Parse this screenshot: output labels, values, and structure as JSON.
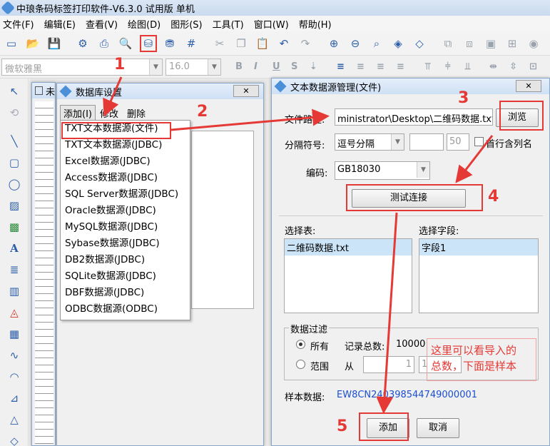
{
  "window": {
    "title": "中琅条码标签打印软件-V6.3.0 试用版 单机"
  },
  "menubar": {
    "items": [
      "文件(F)",
      "编辑(E)",
      "查看(V)",
      "绘图(D)",
      "图形(S)",
      "工具(T)",
      "窗口(W)",
      "帮助(H)"
    ]
  },
  "fontbar": {
    "font": "微软雅黑",
    "size": "16.0"
  },
  "doc_window": {
    "title_fragment": "未"
  },
  "db_dialog": {
    "title": "数据库设置",
    "menu": {
      "add": "添加(I)",
      "edit": "修改",
      "delete": "删除"
    },
    "add_menu_items": [
      "TXT文本数据源(文件)",
      "TXT文本数据源(JDBC)",
      "Excel数据源(JDBC)",
      "Access数据源(JDBC)",
      "SQL Server数据源(JDBC)",
      "Oracle数据源(JDBC)",
      "MySQL数据源(JDBC)",
      "Sybase数据源(JDBC)",
      "DB2数据源(JDBC)",
      "SQLite数据源(JDBC)",
      "DBF数据源(JDBC)",
      "ODBC数据源(ODBC)"
    ]
  },
  "txt_dialog": {
    "title": "文本数据源管理(文件)",
    "file_path_label": "文件路径:",
    "file_path_value": "ministrator\\Desktop\\二维码数据.txt",
    "browse": "浏览",
    "separator_label": "分隔符号:",
    "separator_value": "逗号分隔",
    "separator_num": "50",
    "first_row_header": "首行含列名",
    "encoding_label": "编码:",
    "encoding_value": "GB18030",
    "test_connection": "测试连接",
    "select_table_label": "选择表:",
    "select_field_label": "选择字段:",
    "tables": [
      "二维码数据.txt"
    ],
    "fields": [
      "字段1"
    ],
    "filter_title": "数据过滤",
    "filter_all": "所有",
    "record_total_label": "记录总数:",
    "record_total": "10000",
    "filter_range": "范围",
    "from_label": "从",
    "range_from": "1",
    "range_to": "1",
    "sample_label": "样本数据:",
    "sample_value": "EW8CN240398544749000001",
    "add": "添加",
    "cancel": "取消"
  },
  "annotations": {
    "steps": [
      "1",
      "2",
      "3",
      "4",
      "5"
    ],
    "note_line1": "这里可以看导入的",
    "note_line2": "总数，下面是样本"
  },
  "colors": {
    "annotation": "#e53935",
    "accent": "#2c5ea8",
    "selection": "#cce4f7"
  }
}
